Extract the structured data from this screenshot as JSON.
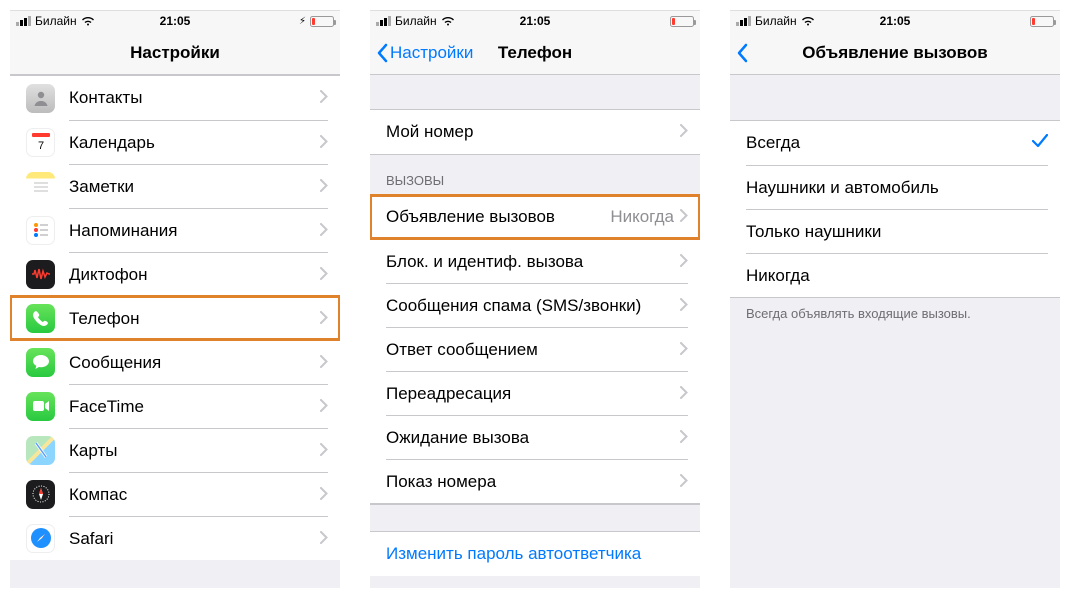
{
  "status": {
    "carrier": "Билайн",
    "time": "21:05"
  },
  "screen1": {
    "title": "Настройки",
    "rows": [
      {
        "label": "Контакты"
      },
      {
        "label": "Календарь"
      },
      {
        "label": "Заметки"
      },
      {
        "label": "Напоминания"
      },
      {
        "label": "Диктофон"
      },
      {
        "label": "Телефон"
      },
      {
        "label": "Сообщения"
      },
      {
        "label": "FaceTime"
      },
      {
        "label": "Карты"
      },
      {
        "label": "Компас"
      },
      {
        "label": "Safari"
      }
    ]
  },
  "screen2": {
    "back": "Настройки",
    "title": "Телефон",
    "my_number": "Мой номер",
    "calls_header": "ВЫЗОВЫ",
    "rows": [
      {
        "label": "Объявление вызовов",
        "detail": "Никогда"
      },
      {
        "label": "Блок. и идентиф. вызова"
      },
      {
        "label": "Сообщения спама (SMS/звонки)"
      },
      {
        "label": "Ответ сообщением"
      },
      {
        "label": "Переадресация"
      },
      {
        "label": "Ожидание вызова"
      },
      {
        "label": "Показ номера"
      }
    ],
    "change_pw": "Изменить пароль автоответчика"
  },
  "screen3": {
    "title": "Объявление вызовов",
    "rows": [
      {
        "label": "Всегда",
        "checked": true
      },
      {
        "label": "Наушники и автомобиль"
      },
      {
        "label": "Только наушники"
      },
      {
        "label": "Никогда"
      }
    ],
    "footer": "Всегда объявлять входящие вызовы."
  },
  "icons": {
    "contacts": {
      "bg": "linear-gradient(#d8d8d8,#bdbdbd)",
      "glyph": "◉"
    },
    "calendar": {
      "bg": "#fff",
      "glyph": "cal"
    },
    "notes": {
      "bg": "#fff",
      "glyph": "notes"
    },
    "reminders": {
      "bg": "#fff",
      "glyph": "rem"
    },
    "voice": {
      "bg": "#1c1c1e",
      "glyph": "wave"
    },
    "phone": {
      "bg": "linear-gradient(#6ee95c,#28c940)",
      "glyph": "phone"
    },
    "messages": {
      "bg": "linear-gradient(#6ee95c,#28c940)",
      "glyph": "bubble"
    },
    "facetime": {
      "bg": "linear-gradient(#6ee95c,#28c940)",
      "glyph": "ft"
    },
    "maps": {
      "bg": "linear-gradient(#8fd6ff,#ffe28a)",
      "glyph": "maps"
    },
    "compass": {
      "bg": "#1c1c1e",
      "glyph": "compass"
    },
    "safari": {
      "bg": "#fff",
      "glyph": "safari"
    }
  }
}
